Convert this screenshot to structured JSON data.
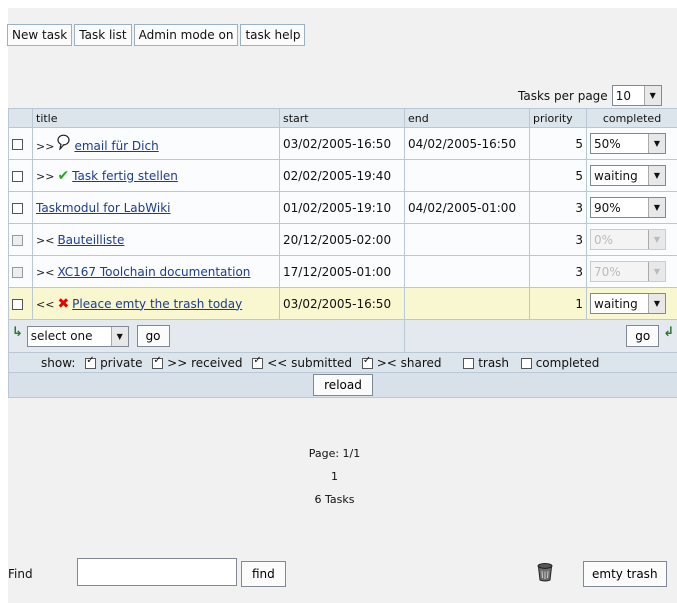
{
  "toolbar": {
    "new_task": "New task",
    "task_list": "Task list",
    "admin_mode": "Admin mode on",
    "task_help": "task help"
  },
  "tasks_per_page": {
    "label": "Tasks per page",
    "value": "10"
  },
  "table": {
    "headers": {
      "title": "title",
      "start": "start",
      "end": "end",
      "priority": "priority",
      "completed": "completed"
    },
    "rows": [
      {
        "prefix": ">>",
        "icon": "speech-bubble-icon",
        "title": "email für Dich",
        "start": "03/02/2005-16:50",
        "end": "04/02/2005-16:50",
        "priority": "5",
        "completed": "50%",
        "disabled": false
      },
      {
        "prefix": ">>",
        "icon": "checkmark-icon",
        "title": "Task fertig stellen",
        "start": "02/02/2005-19:40",
        "end": "",
        "priority": "5",
        "completed": "waiting",
        "disabled": false
      },
      {
        "prefix": "",
        "icon": "",
        "title": "Taskmodul for LabWiki",
        "start": "01/02/2005-19:10",
        "end": "04/02/2005-01:00",
        "priority": "3",
        "completed": "90%",
        "disabled": false
      },
      {
        "prefix": "><",
        "icon": "",
        "title": "Bauteilliste",
        "start": "20/12/2005-02:00",
        "end": "",
        "priority": "3",
        "completed": "0%",
        "disabled": true
      },
      {
        "prefix": "><",
        "icon": "",
        "title": "XC167 Toolchain documentation",
        "start": "17/12/2005-01:00",
        "end": "",
        "priority": "3",
        "completed": "70%",
        "disabled": true
      },
      {
        "prefix": "<<",
        "icon": "red-x-icon",
        "title": "Pleace emty the trash today",
        "start": "03/02/2005-16:50",
        "end": "",
        "priority": "1",
        "completed": "waiting",
        "disabled": false,
        "highlight": true
      }
    ]
  },
  "actions": {
    "select_value": "select one",
    "go_left": "go",
    "go_right": "go"
  },
  "show": {
    "label": "show:",
    "filters": [
      {
        "label": "private",
        "checked": true
      },
      {
        "label": ">> received",
        "checked": true
      },
      {
        "label": "<< submitted",
        "checked": true
      },
      {
        "label": ">< shared",
        "checked": true
      },
      {
        "label": "trash",
        "checked": false
      },
      {
        "label": "completed",
        "checked": false
      }
    ]
  },
  "reload_label": "reload",
  "pager": {
    "page": "Page: 1/1",
    "page_number": "1",
    "count": "6 Tasks"
  },
  "find": {
    "label": "Find",
    "value": "",
    "button": "find"
  },
  "empty_trash": "emty trash"
}
